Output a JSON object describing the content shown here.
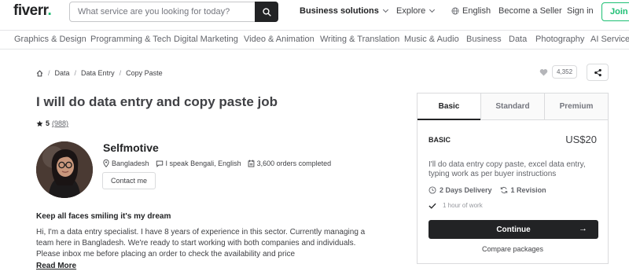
{
  "header": {
    "logo": "fiverr",
    "logo_dot": ".",
    "search_placeholder": "What service are you looking for today?",
    "links": {
      "business": "Business solutions",
      "explore": "Explore",
      "language": "English",
      "seller": "Become a Seller",
      "signin": "Sign in",
      "join": "Join"
    }
  },
  "categories": [
    "Graphics & Design",
    "Programming & Tech",
    "Digital Marketing",
    "Video & Animation",
    "Writing & Translation",
    "Music & Audio",
    "Business",
    "Data",
    "Photography",
    "AI Services"
  ],
  "breadcrumb": [
    "Data",
    "Data Entry",
    "Copy Paste"
  ],
  "likes_count": "4,352",
  "gig": {
    "title": "I will do data entry and copy paste job",
    "rating": "5",
    "reviews": "(988)",
    "tagline": "Keep all faces smiling it's my dream",
    "description": "Hi, I'm a data entry specialist. I have 8 years of experience in this sector. Currently managing a team here in Bangladesh. We're ready to start working with both companies and individuals. Please inbox me before placing an order to check the availability and price",
    "read_more": "Read More"
  },
  "seller": {
    "name": "Selfmotive",
    "country": "Bangladesh",
    "languages": "I speak Bengali, English",
    "orders": "3,600 orders completed",
    "contact": "Contact me"
  },
  "package": {
    "tabs": [
      "Basic",
      "Standard",
      "Premium"
    ],
    "name": "BASIC",
    "price": "US$20",
    "description": "I'll do data entry copy paste, excel data entry, typing work as per buyer instructions",
    "delivery": "2 Days Delivery",
    "revisions": "1 Revision",
    "includes": "1 hour of work",
    "continue": "Continue",
    "compare": "Compare packages"
  },
  "colors": {
    "brand": "#1dbf73",
    "dark": "#222325"
  }
}
